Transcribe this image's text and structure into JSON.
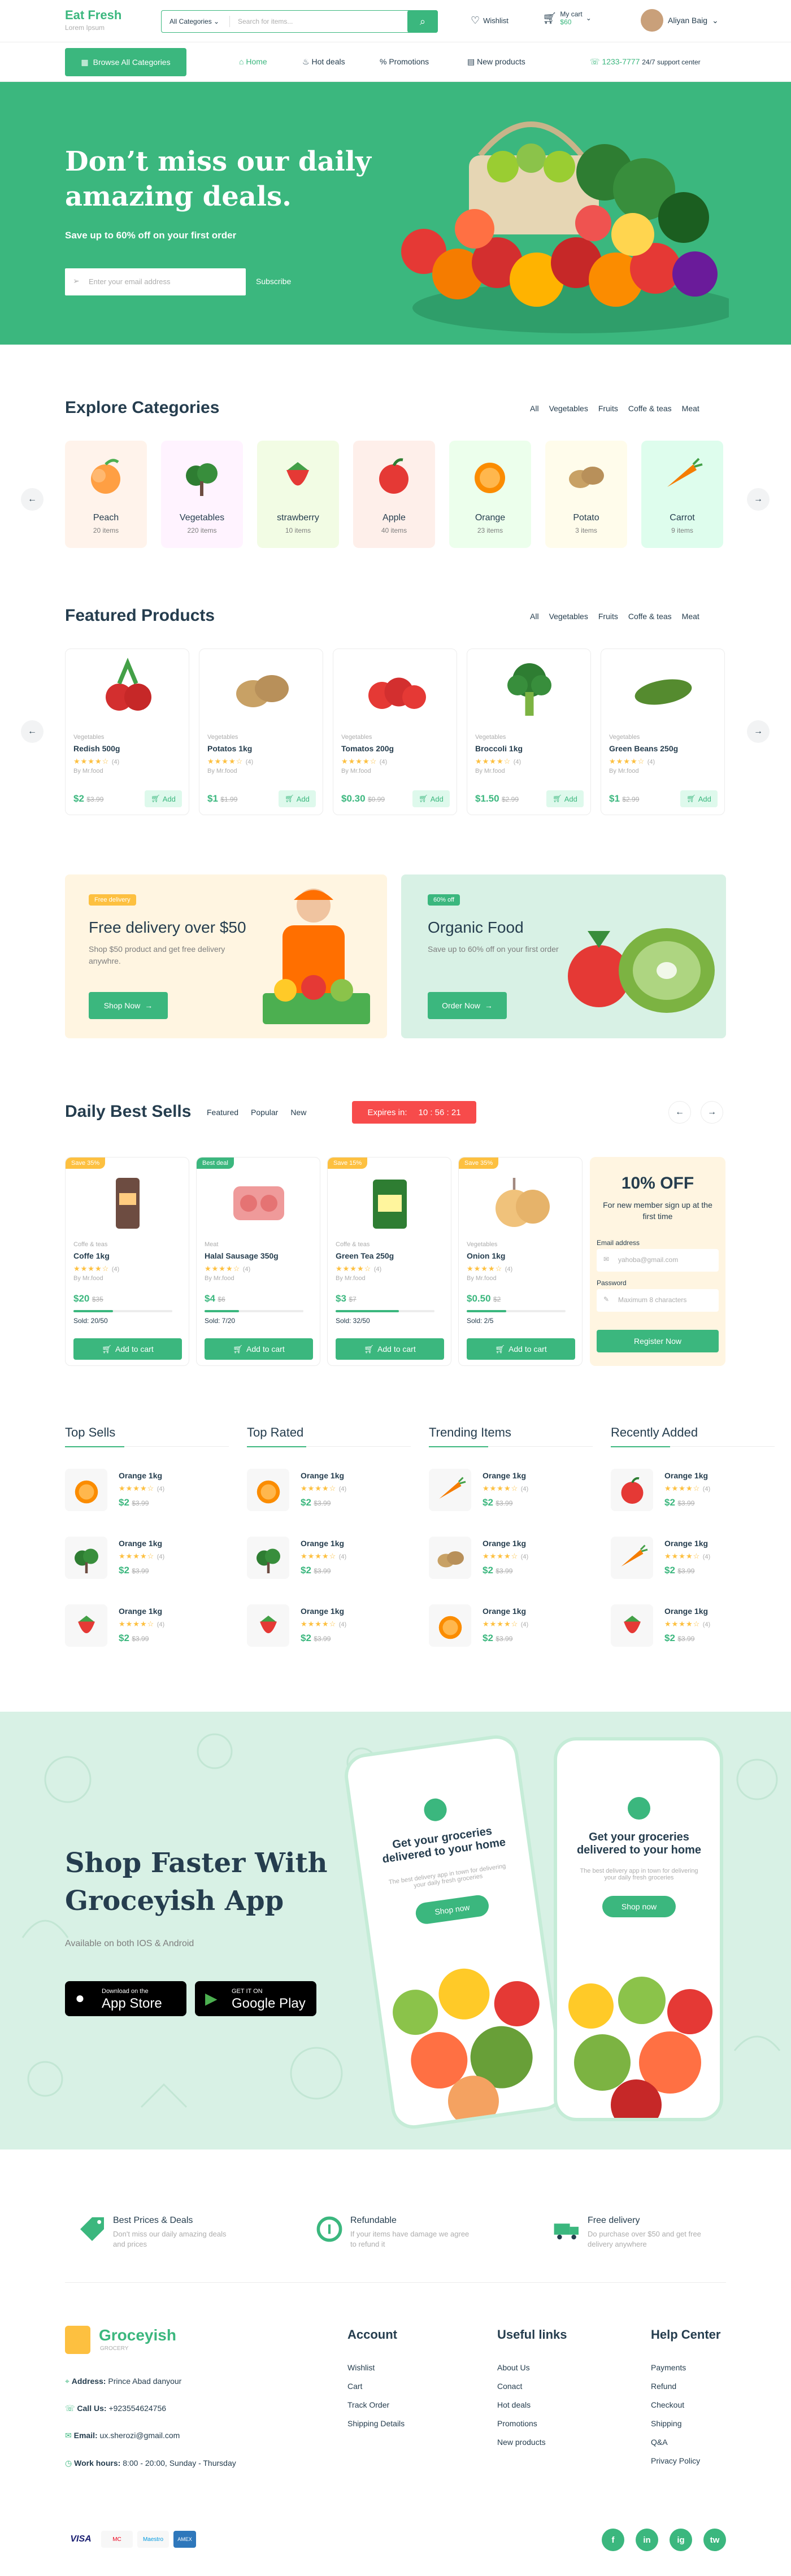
{
  "header": {
    "logo": "Eat Fresh",
    "tagline": "Lorem Ipsum",
    "category_select": "All Categories",
    "search_placeholder": "Search for items...",
    "wishlist": "Wishlist",
    "cart_label": "My cart",
    "cart_total": "$60",
    "user_name": "Aliyan Baig"
  },
  "nav": {
    "browse": "Browse All Categories",
    "items": [
      "Home",
      "Hot deals",
      "Promotions",
      "New products"
    ],
    "phone": "1233-7777",
    "support": "24/7 support center"
  },
  "hero": {
    "title_line1": "Don’t miss our daily",
    "title_line2": "amazing deals.",
    "subtitle": "Save up to 60% off on your first order",
    "email_placeholder": "Enter your email address",
    "subscribe": "Subscribe"
  },
  "explore": {
    "title": "Explore Categories",
    "tabs": [
      "All",
      "Vegetables",
      "Fruits",
      "Coffe & teas",
      "Meat"
    ],
    "categories": [
      {
        "name": "Peach",
        "count": "20 items",
        "bg": "#fff3eb",
        "icon": "peach-icon"
      },
      {
        "name": "Vegetables",
        "count": "220 items",
        "bg": "#fff3ff",
        "icon": "vegetables-icon"
      },
      {
        "name": "strawberry",
        "count": "10 items",
        "bg": "#f2fce4",
        "icon": "strawberry-icon"
      },
      {
        "name": "Apple",
        "count": "40 items",
        "bg": "#feefea",
        "icon": "apple-icon"
      },
      {
        "name": "Orange",
        "count": "23 items",
        "bg": "#ecffec",
        "icon": "orange-icon"
      },
      {
        "name": "Potato",
        "count": "3 items",
        "bg": "#fffceb",
        "icon": "potato-icon"
      },
      {
        "name": "Carrot",
        "count": "9 items",
        "bg": "#defded",
        "icon": "carrot-icon"
      }
    ]
  },
  "featured": {
    "title": "Featured Products",
    "tabs": [
      "All",
      "Vegetables",
      "Fruits",
      "Coffe & teas",
      "Meat"
    ],
    "products": [
      {
        "category": "Vegetables",
        "name": "Redish 500g",
        "rating": "(4)",
        "brand": "By Mr.food",
        "price": "$2",
        "old": "$3.99",
        "add": "Add",
        "icon": "radish-icon"
      },
      {
        "category": "Vegetables",
        "name": "Potatos 1kg",
        "rating": "(4)",
        "brand": "By Mr.food",
        "price": "$1",
        "old": "$1.99",
        "add": "Add",
        "icon": "potato-icon"
      },
      {
        "category": "Vegetables",
        "name": "Tomatos 200g",
        "rating": "(4)",
        "brand": "By Mr.food",
        "price": "$0.30",
        "old": "$0.99",
        "add": "Add",
        "icon": "tomato-icon"
      },
      {
        "category": "Vegetables",
        "name": "Broccoli 1kg",
        "rating": "(4)",
        "brand": "By Mr.food",
        "price": "$1.50",
        "old": "$2.99",
        "add": "Add",
        "icon": "broccoli-icon"
      },
      {
        "category": "Vegetables",
        "name": "Green Beans 250g",
        "rating": "(4)",
        "brand": "By Mr.food",
        "price": "$1",
        "old": "$2.99",
        "add": "Add",
        "icon": "beans-icon"
      }
    ]
  },
  "promo": {
    "delivery_badge": "Free delivery",
    "delivery_title": "Free delivery over $50",
    "delivery_text": "Shop $50 product and get free delivery anywhre.",
    "shop_now": "Shop Now",
    "organic_badge": "60% off",
    "organic_title": "Organic Food",
    "organic_text": "Save up to 60% off on your first order",
    "order_now": "Order Now"
  },
  "daily": {
    "title": "Daily Best Sells",
    "tabs": [
      "Featured",
      "Popular",
      "New"
    ],
    "expires": "Expires in:",
    "timer": "10 : 56 : 21",
    "products": [
      {
        "badge": "Save 35%",
        "category": "Coffe & teas",
        "name": "Coffe 1kg",
        "rating": "(4)",
        "brand": "By Mr.food",
        "price": "$20",
        "old": "$35",
        "sold": "Sold: 20/50",
        "sold_frac": 0.4,
        "add": "Add to cart",
        "badge_color": "#fdc040",
        "icon": "coffee-icon"
      },
      {
        "badge": "Best deal",
        "category": "Meat",
        "name": "Halal Sausage 350g",
        "rating": "(4)",
        "brand": "By Mr.food",
        "price": "$4",
        "old": "$6",
        "sold": "Sold: 7/20",
        "sold_frac": 0.35,
        "add": "Add to cart",
        "badge_color": "#3bb77e",
        "icon": "sausage-icon"
      },
      {
        "badge": "Save 15%",
        "category": "Coffe & teas",
        "name": "Green Tea 250g",
        "rating": "(4)",
        "brand": "By Mr.food",
        "price": "$3",
        "old": "$7",
        "sold": "Sold: 32/50",
        "sold_frac": 0.64,
        "add": "Add to cart",
        "badge_color": "#fdc040",
        "icon": "tea-icon"
      },
      {
        "badge": "Save 35%",
        "category": "Vegetables",
        "name": "Onion 1kg",
        "rating": "(4)",
        "brand": "By Mr.food",
        "price": "$0.50",
        "old": "$2",
        "sold": "Sold: 2/5",
        "sold_frac": 0.4,
        "add": "Add to cart",
        "badge_color": "#fdc040",
        "icon": "onion-icon"
      }
    ],
    "signup": {
      "title": "10% OFF",
      "text": "For new member sign up at the first time",
      "email_label": "Email address",
      "email_placeholder": "yahoba@gmail.com",
      "password_label": "Password",
      "password_placeholder": "Maximum 8 characters",
      "register": "Register Now"
    }
  },
  "lists": [
    {
      "title": "Top Sells",
      "items": [
        {
          "name": "Orange 1kg",
          "price": "$2",
          "old": "$3.99",
          "rating": "(4)",
          "icon": "orange-icon"
        },
        {
          "name": "Orange 1kg",
          "price": "$2",
          "old": "$3.99",
          "rating": "(4)",
          "icon": "vegetables-icon"
        },
        {
          "name": "Orange 1kg",
          "price": "$2",
          "old": "$3.99",
          "rating": "(4)",
          "icon": "strawberry-icon"
        }
      ]
    },
    {
      "title": "Top Rated",
      "items": [
        {
          "name": "Orange 1kg",
          "price": "$2",
          "old": "$3.99",
          "rating": "(4)",
          "icon": "orange-icon"
        },
        {
          "name": "Orange 1kg",
          "price": "$2",
          "old": "$3.99",
          "rating": "(4)",
          "icon": "vegetables-icon"
        },
        {
          "name": "Orange 1kg",
          "price": "$2",
          "old": "$3.99",
          "rating": "(4)",
          "icon": "strawberry-icon"
        }
      ]
    },
    {
      "title": "Trending Items",
      "items": [
        {
          "name": "Orange 1kg",
          "price": "$2",
          "old": "$3.99",
          "rating": "(4)",
          "icon": "carrot-icon"
        },
        {
          "name": "Orange 1kg",
          "price": "$2",
          "old": "$3.99",
          "rating": "(4)",
          "icon": "potato-icon"
        },
        {
          "name": "Orange 1kg",
          "price": "$2",
          "old": "$3.99",
          "rating": "(4)",
          "icon": "orange-icon"
        }
      ]
    },
    {
      "title": "Recently Added",
      "items": [
        {
          "name": "Orange 1kg",
          "price": "$2",
          "old": "$3.99",
          "rating": "(4)",
          "icon": "apple-icon"
        },
        {
          "name": "Orange 1kg",
          "price": "$2",
          "old": "$3.99",
          "rating": "(4)",
          "icon": "carrot-icon"
        },
        {
          "name": "Orange 1kg",
          "price": "$2",
          "old": "$3.99",
          "rating": "(4)",
          "icon": "strawberry-icon"
        }
      ]
    }
  ],
  "app": {
    "title_line1": "Shop Faster With",
    "title_line2": "Groceyish App",
    "subtitle": "Available on both IOS & Android",
    "appstore_small": "Download on the",
    "appstore_big": "App Store",
    "play_small": "GET IT ON",
    "play_big": "Google Play",
    "phone_title": "Get your groceries delivered to your home",
    "phone_text": "The best delivery app in town for delivering your daily fresh groceries",
    "phone_btn": "Shop now"
  },
  "features": [
    {
      "title": "Best Prices & Deals",
      "text": "Don't miss our daily amazing deals and prices",
      "icon": "tag-icon"
    },
    {
      "title": "Refundable",
      "text": "If your items have damage we agree to refund it",
      "icon": "refund-icon"
    },
    {
      "title": "Free delivery",
      "text": "Do purchase over $50 and get free delivery anywhere",
      "icon": "truck-icon"
    }
  ],
  "footer": {
    "brand": "Groceyish",
    "brand_sub": "GROCERY",
    "address_label": "Address:",
    "address": "Prince Abad danyour",
    "call_label": "Call Us:",
    "call": "+923554624756",
    "email_label": "Email:",
    "email": "ux.sherozi@gmail.com",
    "hours_label": "Work hours:",
    "hours": "8:00 - 20:00, Sunday - Thursday",
    "columns": [
      {
        "title": "Account",
        "links": [
          "Wishlist",
          "Cart",
          "Track Order",
          "Shipping Details"
        ]
      },
      {
        "title": "Useful links",
        "links": [
          "About Us",
          "Conact",
          "Hot deals",
          "Promotions",
          "New products"
        ]
      },
      {
        "title": "Help Center",
        "links": [
          "Payments",
          "Refund",
          "Checkout",
          "Shipping",
          "Q&A",
          "Privacy Policy"
        ]
      }
    ],
    "payments": [
      "VISA",
      "MC",
      "Maestro",
      "AMEX"
    ],
    "socials": [
      "f",
      "in",
      "ig",
      "tw"
    ]
  },
  "colors": {
    "brand": "#3bb77e",
    "heading": "#253d4e",
    "star": "#fdc040",
    "timer": "#f74b4b"
  }
}
